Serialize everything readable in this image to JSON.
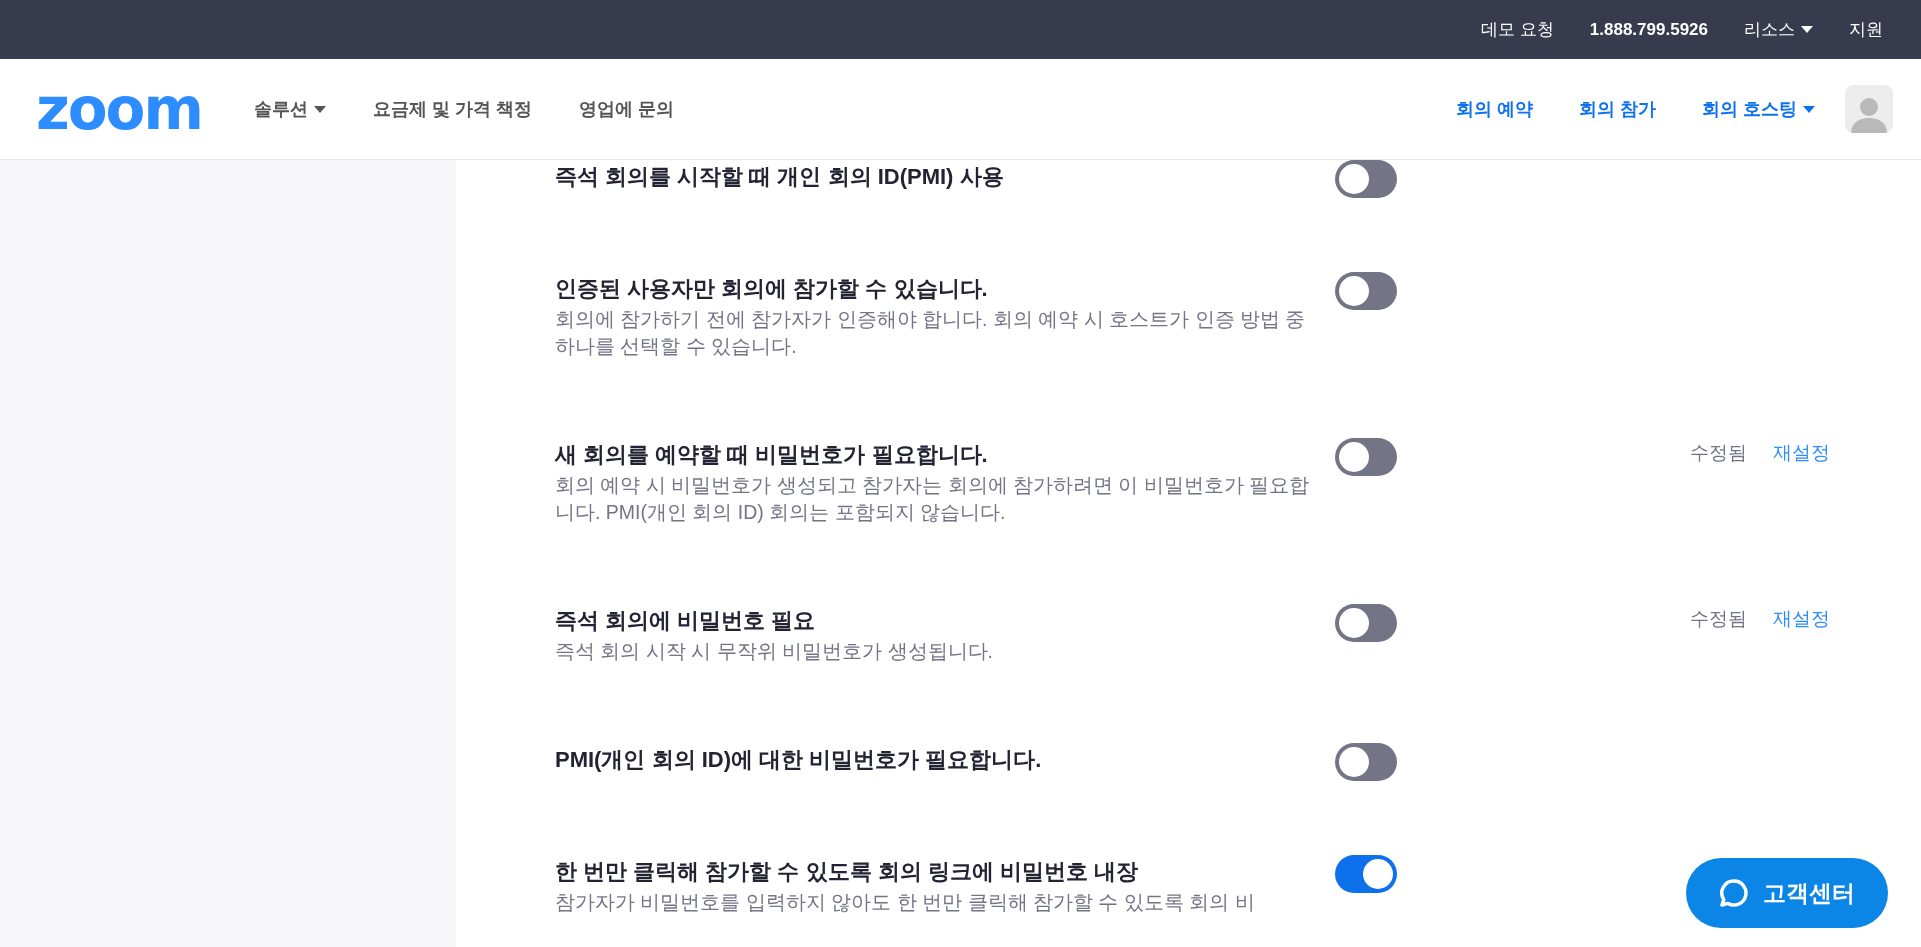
{
  "top_bar": {
    "links": [
      {
        "label": "데모 요청",
        "kind": "link"
      },
      {
        "label": "1.888.799.5926",
        "kind": "phone"
      },
      {
        "label": "리소스",
        "kind": "dropdown"
      },
      {
        "label": "지원",
        "kind": "link"
      }
    ]
  },
  "header": {
    "logo": "zoom",
    "nav": [
      {
        "label": "솔루션",
        "dropdown": true
      },
      {
        "label": "요금제 및 가격 책정",
        "dropdown": false
      },
      {
        "label": "영업에 문의",
        "dropdown": false
      }
    ],
    "actions": [
      {
        "label": "회의 예약",
        "dropdown": false
      },
      {
        "label": "회의 참가",
        "dropdown": false
      },
      {
        "label": "회의 호스팅",
        "dropdown": true
      }
    ]
  },
  "settings": [
    {
      "title": "즉석 회의를 시작할 때 개인 회의 ID(PMI) 사용",
      "on": false
    },
    {
      "title": "인증된 사용자만 회의에 참가할 수 있습니다.",
      "description": "회의에 참가하기 전에 참가자가 인증해야 합니다. 회의 예약 시 호스트가 인증 방법 중 하나를 선택할 수 있습니다.",
      "on": false
    },
    {
      "title": "새 회의를 예약할 때 비밀번호가 필요합니다.",
      "description": "회의 예약 시 비밀번호가 생성되고 참가자는 회의에 참가하려면 이 비밀번호가 필요합니다. PMI(개인 회의 ID) 회의는 포함되지 않습니다.",
      "on": false,
      "status": "수정됨",
      "action": "재설정"
    },
    {
      "title": "즉석 회의에 비밀번호 필요",
      "description": "즉석 회의 시작 시 무작위 비밀번호가 생성됩니다.",
      "on": false,
      "status": "수정됨",
      "action": "재설정"
    },
    {
      "title": "PMI(개인 회의 ID)에 대한 비밀번호가 필요합니다.",
      "on": false
    },
    {
      "title": "한 번만 클릭해 참가할 수 있도록 회의 링크에 비밀번호 내장",
      "description": "참가자가 비밀번호를 입력하지 않아도 한 번만 클릭해 참가할 수 있도록 회의 비",
      "on": true
    }
  ],
  "help_button": {
    "label": "고객센터"
  }
}
